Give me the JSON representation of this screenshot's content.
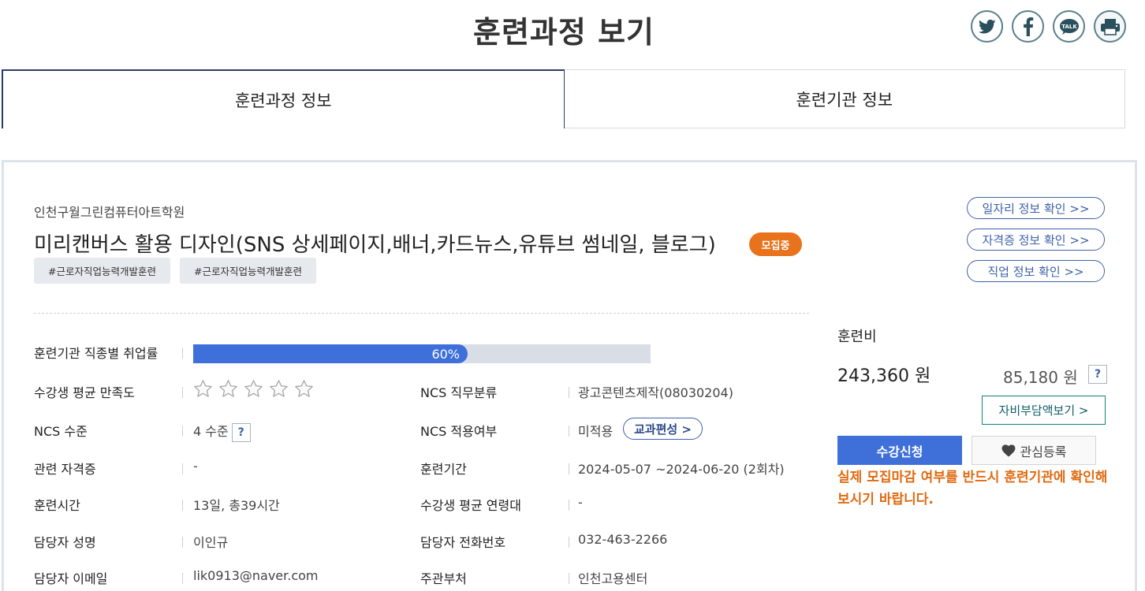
{
  "page": {
    "title": "훈련과정 보기"
  },
  "share": {
    "icons": [
      "twitter-icon",
      "facebook-icon",
      "kakaotalk-icon",
      "print-icon"
    ],
    "kakao_text": "TALK"
  },
  "tabs": [
    {
      "label": "훈련과정 정보",
      "active": true
    },
    {
      "label": "훈련기관 정보",
      "active": false
    }
  ],
  "course": {
    "academy": "인천구월그린컴퓨터아트학원",
    "title": "미리캔버스 활용 디자인(SNS 상세페이지,배너,카드뉴스,유튜브 썸네일, 블로그)",
    "status_badge": "모집중",
    "tags": [
      "#근로자직업능력개발훈련",
      "#근로자직업능력개발훈련"
    ]
  },
  "links": [
    {
      "label": "일자리 정보 확인 >>"
    },
    {
      "label": "자격증 정보 확인 >>"
    },
    {
      "label": "직업 정보 확인 >>"
    }
  ],
  "details": {
    "employment_rate": {
      "label": "훈련기관 직종별 취업률",
      "value_text": "60%",
      "value": 0.6
    },
    "satisfaction": {
      "label": "수강생 평균 만족도",
      "stars_filled": 0,
      "stars_total": 5
    },
    "ncs_job": {
      "label": "NCS 직무분류",
      "value": "광고콘텐츠제작(08030204)"
    },
    "ncs_level": {
      "label": "NCS 수준",
      "value": "4 수준",
      "help": "?"
    },
    "ncs_applied": {
      "label": "NCS 적용여부",
      "value": "미적용",
      "button": "교과편성 >"
    },
    "certificate": {
      "label": "관련 자격증",
      "value": "-"
    },
    "period": {
      "label": "훈련기간",
      "value": "2024-05-07 ~2024-06-20 (2회차)"
    },
    "hours": {
      "label": "훈련시간",
      "value": "13일, 총39시간"
    },
    "avg_age": {
      "label": "수강생 평균 연령대",
      "value": "-"
    },
    "manager_name": {
      "label": "담당자 성명",
      "value": "이인규"
    },
    "manager_phone": {
      "label": "담당자 전화번호",
      "value": "032-463-2266"
    },
    "manager_email": {
      "label": "담당자 이메일",
      "value": "lik0913@naver.com"
    },
    "agency": {
      "label": "주관부처",
      "value": "인천고용센터"
    }
  },
  "fee": {
    "label": "훈련비",
    "total": "243,360 원",
    "self_pay": "85,180 원",
    "help": "?",
    "self_pay_button": "자비부담액보기 >",
    "apply_button": "수강신청",
    "favorite_button": "관심등록",
    "notice": "실제 모집마감 여부를 반드시 훈련기관에 확인해보시기 바랍니다."
  },
  "colors": {
    "accent_blue": "#3f70da",
    "badge_orange": "#e8731c",
    "notice_orange": "#e06a10",
    "link_blue": "#3f62a8",
    "teal": "#148080"
  }
}
